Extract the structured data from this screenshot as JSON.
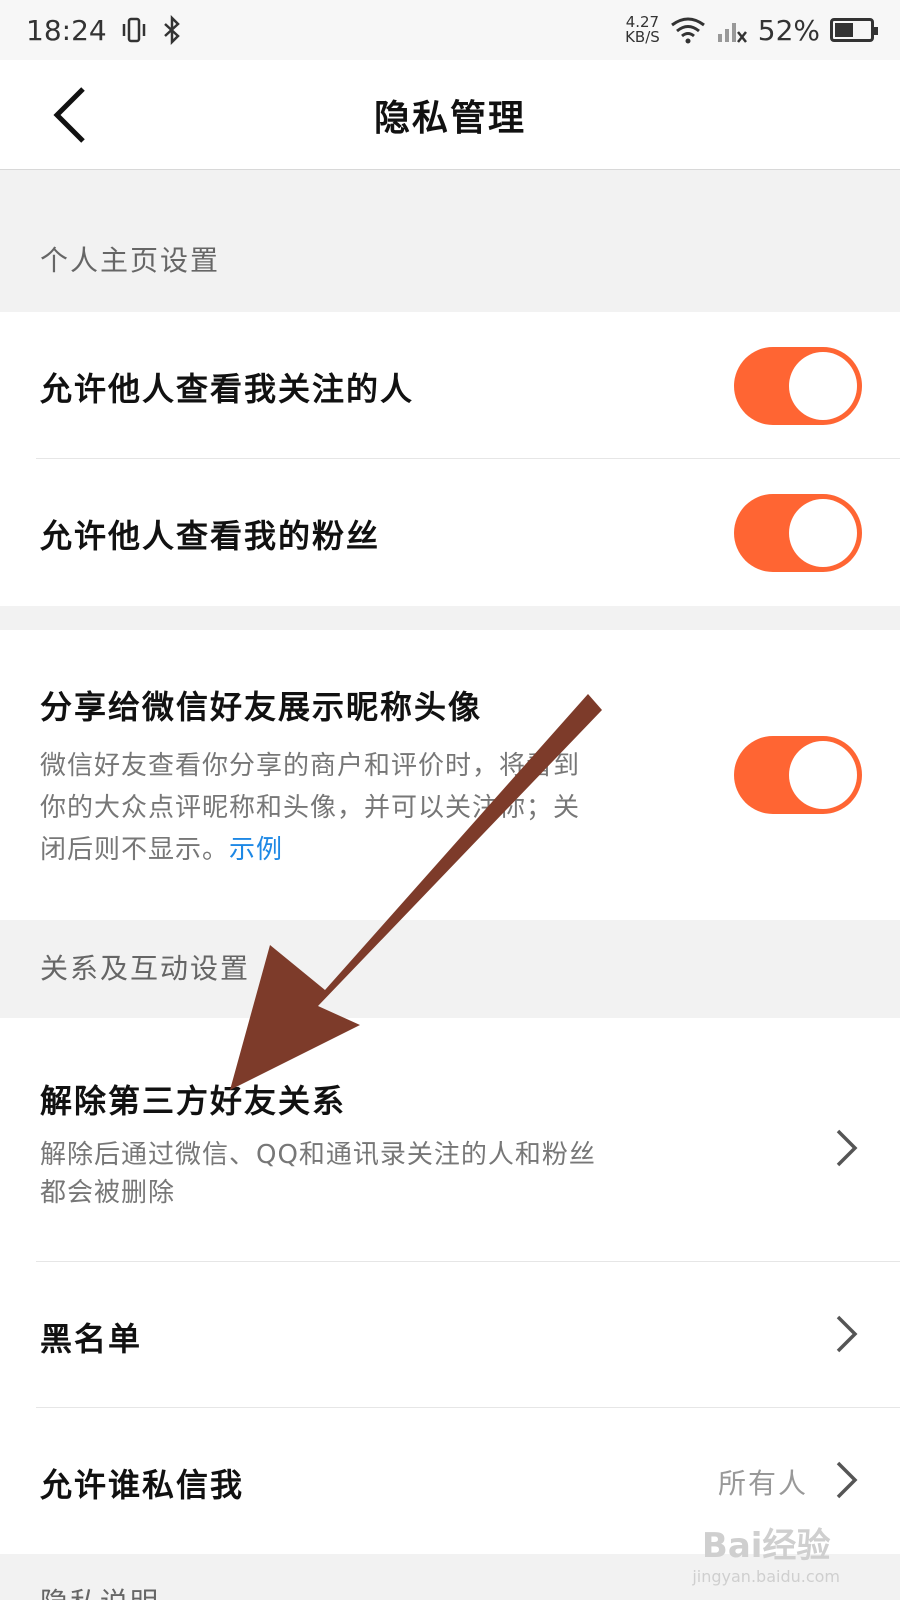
{
  "status_bar": {
    "time": "18:24",
    "net_speed_value": "4.27",
    "net_speed_unit": "KB/S",
    "battery": "52%",
    "icons": [
      "vibrate-icon",
      "bluetooth-icon",
      "wifi-icon",
      "signal-icon",
      "battery-icon"
    ]
  },
  "nav": {
    "title": "隐私管理",
    "back_icon": "chevron-left-icon"
  },
  "sections": {
    "profile": {
      "header": "个人主页设置"
    },
    "relations": {
      "header": "关系及互动设置"
    },
    "privacy": {
      "header": "隐私说明"
    }
  },
  "rows": {
    "follow_visible": {
      "label": "允许他人查看我关注的人",
      "enabled": true
    },
    "fans_visible": {
      "label": "允许他人查看我的粉丝",
      "enabled": true
    },
    "wechat_share": {
      "label": "分享给微信好友展示昵称头像",
      "desc_line1": "微信好友查看你分享的商户和评价时，将看到",
      "desc_line2": "你的大众点评昵称和头像，并可以关注你；关",
      "desc_line3": "闭后则不显示。",
      "link": "示例",
      "enabled": true
    },
    "third_party": {
      "label": "解除第三方好友关系",
      "desc_line1": "解除后通过微信、QQ和通讯录关注的人和粉丝",
      "desc_line2": "都会被删除"
    },
    "blacklist": {
      "label": "黑名单"
    },
    "who_can_message": {
      "label": "允许谁私信我",
      "value": "所有人"
    }
  },
  "colors": {
    "toggle_on": "#ff6533",
    "link": "#1e88e5",
    "annotation_arrow": "#7d3b2a"
  },
  "watermark": {
    "text": "Bai经验",
    "sub": "jingyan.baidu.com"
  }
}
